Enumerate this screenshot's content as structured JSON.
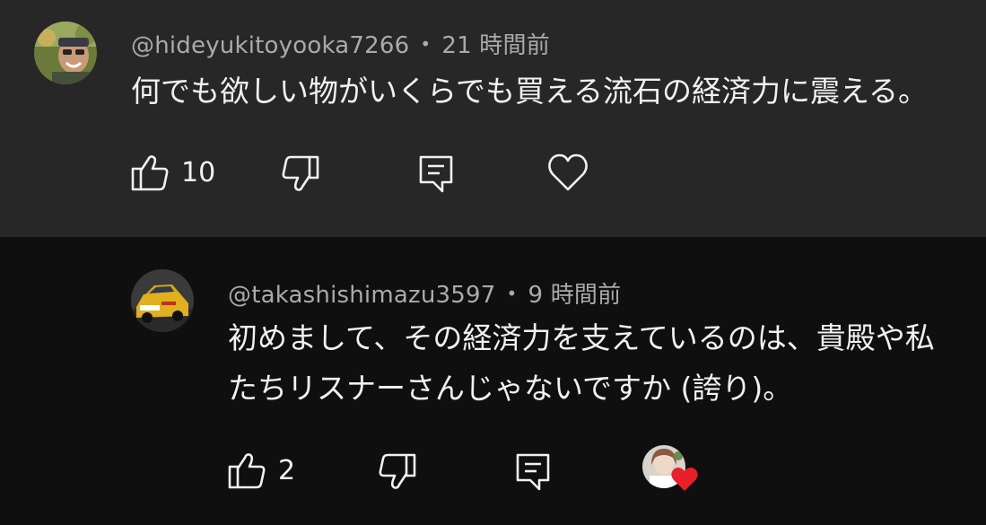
{
  "comments": [
    {
      "author": "@hideyukitoyooka7266",
      "separator": "•",
      "time": "21 時間前",
      "text_lines": [
        "何でも欲しい物がいくらでも買える流石の経済力に震える。"
      ],
      "likes": "10"
    },
    {
      "author": "@takashishimazu3597",
      "separator": "•",
      "time": "9 時間前",
      "text_lines": [
        "初めまして、その経済力を支えているのは、貴殿や私",
        "たちリスナーさんじゃないですか (誇り)。"
      ],
      "likes": "2"
    }
  ],
  "colors": {
    "top_background": "#272727",
    "reply_background": "#0f0f0f",
    "meta_text": "#aaaaaa",
    "heart": "#e8202a"
  },
  "icons": [
    "thumbs-up-icon",
    "thumbs-down-icon",
    "reply-icon",
    "heart-icon",
    "creator-heart-icon"
  ]
}
